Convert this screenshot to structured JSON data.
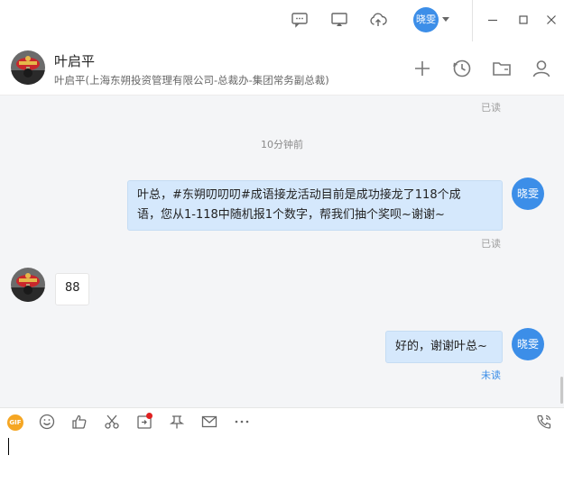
{
  "topbar": {
    "icons": [
      "chat-bubble-icon",
      "screen-share-icon",
      "cloud-upload-icon"
    ],
    "me_avatar_text": "晓雯",
    "window_controls": [
      "minimize-icon",
      "maximize-icon",
      "close-icon"
    ]
  },
  "contact": {
    "name": "叶启平",
    "subtitle": "叶启平(上海东朔投资管理有限公司-总裁办-集团常务副总裁)",
    "header_icons": [
      "add-icon",
      "history-icon",
      "folder-icon",
      "profile-icon"
    ]
  },
  "chat": {
    "prev_read_status": "已读",
    "time_label": "10分钟前",
    "messages": [
      {
        "direction": "out",
        "sender_avatar_text": "晓雯",
        "lines": [
          "叶总，#东朔叨叨叨#成语接龙活动目前是成功接龙了118个成",
          "语，您从1-118中随机报1个数字，帮我们抽个奖呗~谢谢~"
        ],
        "status": "已读"
      },
      {
        "direction": "in",
        "text": "88"
      },
      {
        "direction": "out",
        "sender_avatar_text": "晓雯",
        "text": "好的，谢谢叶总~",
        "status": "未读"
      }
    ]
  },
  "toolbar": {
    "gif_label": "GIF",
    "icons": [
      "gif-icon",
      "emoji-icon",
      "thumbs-up-icon",
      "scissors-icon",
      "screen-capture-icon",
      "pin-icon",
      "mail-icon",
      "more-icon",
      "phone-icon"
    ]
  },
  "colors": {
    "accent": "#3c8ee8",
    "bubble_out": "#d5e8fc",
    "chat_bg": "#f4f5f7",
    "unread": "#3c8ee8",
    "gif_orange": "#f5a623",
    "notify_red": "#e02020"
  }
}
